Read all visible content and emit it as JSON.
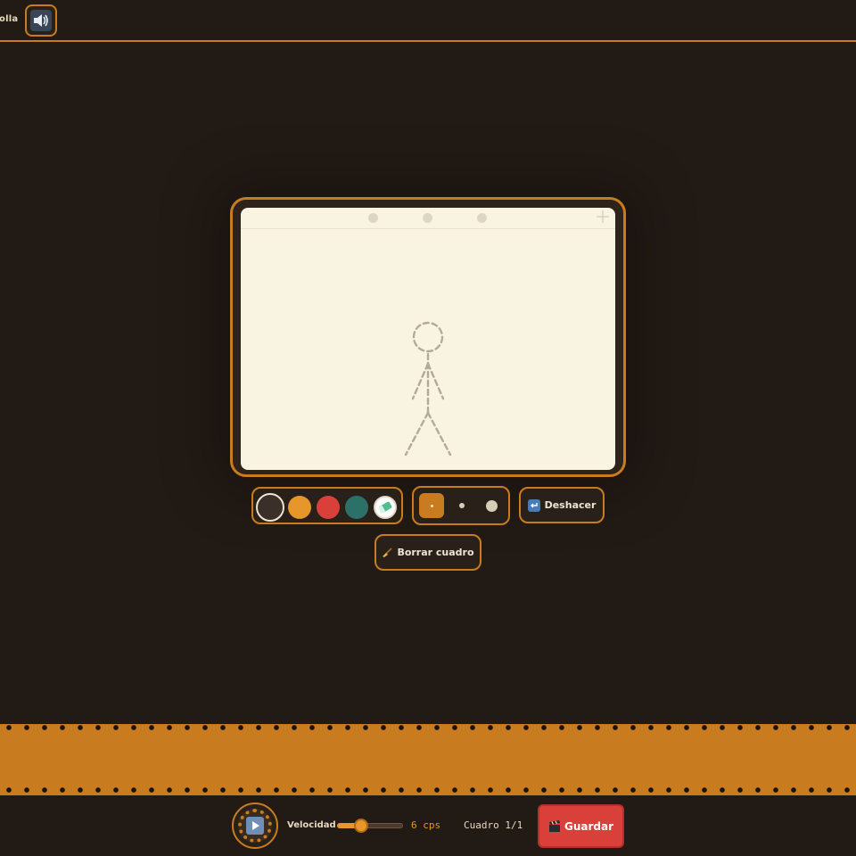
{
  "header": {
    "app_title": "olla",
    "sound_icon": "speaker-icon"
  },
  "canvas": {
    "paper_color": "#f9f3e2",
    "figure": "dashed stick figure guide"
  },
  "palette": {
    "colors": [
      "#3a2f29",
      "#e6962b",
      "#d9403a",
      "#2c7168",
      "#ffffff"
    ],
    "selected_index": 0,
    "eraser_icon": "eraser-icon"
  },
  "brush_sizes": {
    "options": [
      "small",
      "medium",
      "large"
    ],
    "selected": "small"
  },
  "buttons": {
    "undo_label": "Deshacer",
    "undo_icon": "undo-icon",
    "clear_label": "Borrar cuadro",
    "clear_icon": "broom-icon",
    "save_label": "Guardar",
    "save_icon": "clapperboard-icon"
  },
  "playback": {
    "play_icon": "play-icon",
    "speed_label": "Velocidad",
    "speed_value": "6 cps",
    "speed_fraction": 0.33,
    "frame_counter": "Cuadro 1/1"
  },
  "colors": {
    "accent": "#c97c1f",
    "background": "#221a15",
    "save": "#d9403a"
  }
}
